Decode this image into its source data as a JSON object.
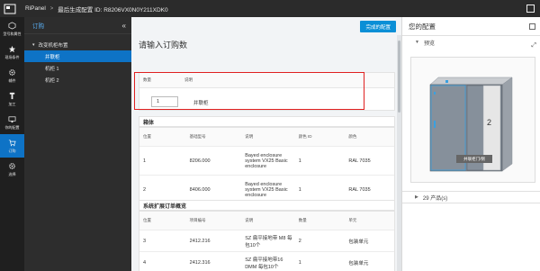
{
  "topbar": {
    "app_name": "RiPanel",
    "config_name": "最后生成配置 ID: R8206VX0N0Y211XDK0"
  },
  "rail": {
    "items": [
      {
        "label": "型号和属性",
        "icon": "cube-icon"
      },
      {
        "label": "现场条件",
        "icon": "star-icon"
      },
      {
        "label": "辅件",
        "icon": "gear-icon"
      },
      {
        "label": "加工",
        "icon": "tools-icon"
      },
      {
        "label": "你的配置",
        "icon": "monitor-icon"
      },
      {
        "label": "订购",
        "icon": "cart-icon"
      },
      {
        "label": "选择",
        "icon": "gear-icon"
      }
    ],
    "active_index": 5
  },
  "tree": {
    "title": "订购",
    "group": "改变机柜布置",
    "items": [
      "并联柜",
      "机柜 1",
      "机柜 2"
    ],
    "selected_index": 0
  },
  "main": {
    "finish_button": "完成的配置",
    "heading": "请输入订购数",
    "qty_table": {
      "headers": [
        "数量",
        "说明"
      ],
      "quantity": "1",
      "description": "并联柜"
    },
    "cabinet_section": {
      "title": "箱体",
      "headers": [
        "位置",
        "基础型号",
        "说明",
        "颜色 ID",
        "颜色"
      ],
      "rows": [
        {
          "pos": "1",
          "model": "8206.000",
          "desc": "Bayed enclosure system VX25 Basic enclosure",
          "color_id": "1",
          "color": "RAL 7035"
        },
        {
          "pos": "2",
          "model": "8406.000",
          "desc": "Bayed enclosure system VX25 Basic enclosure",
          "color_id": "1",
          "color": "RAL 7035"
        }
      ]
    },
    "extension_section": {
      "title": "系统扩展订单概览",
      "headers": [
        "位置",
        "项目编号",
        "说明",
        "数量",
        "单元"
      ],
      "rows": [
        {
          "pos": "3",
          "model": "2412.216",
          "desc": "SZ 扁平接地带 M8 每包10个",
          "qty": "2",
          "unit": "包装单元"
        },
        {
          "pos": "4",
          "model": "2412.316",
          "desc": "SZ 扁平接地带16 DMM 每包10个",
          "qty": "1",
          "unit": "包装单元"
        }
      ]
    }
  },
  "config": {
    "title": "您的配置",
    "preview_label": "预览",
    "cabinet_caption": "并联柜门/侧",
    "bay_label": "2",
    "products_label": "29 产品(s)"
  }
}
